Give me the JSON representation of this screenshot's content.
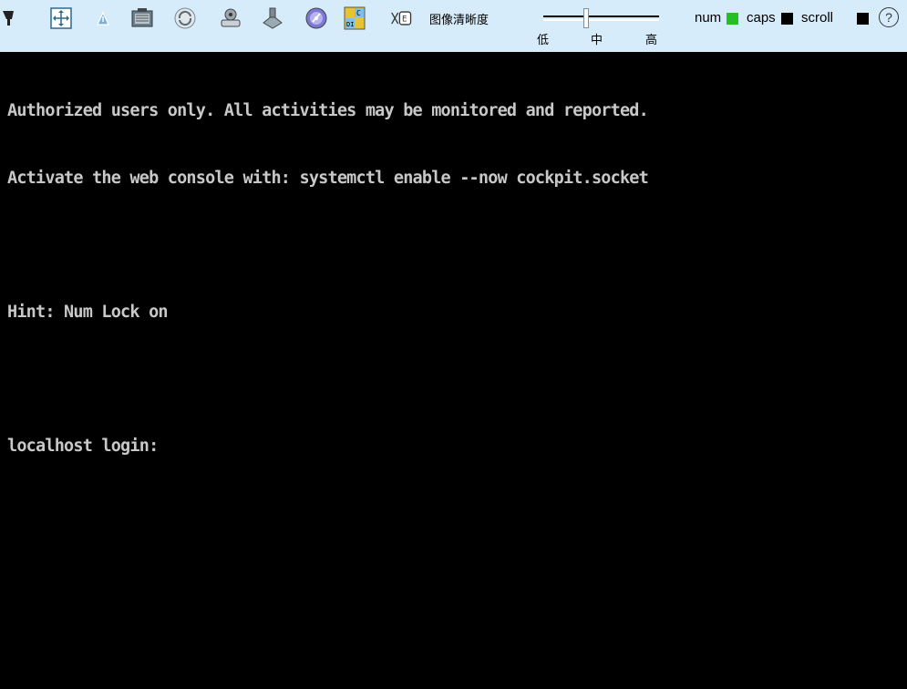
{
  "toolbar": {
    "quality_label": "图像清晰度",
    "slider_ticks": [
      "低",
      "中",
      "高"
    ],
    "slider_value": "中",
    "indicators": [
      {
        "label": "num",
        "color": "#22c022",
        "state": "on"
      },
      {
        "label": "caps",
        "color": "#000000",
        "state": "off"
      },
      {
        "label": "scroll",
        "color": "#000000",
        "state": "off"
      }
    ],
    "help_glyph": "?",
    "icons": [
      "cursor-icon",
      "move-icon",
      "mouse-pointer-icon",
      "screenshot-icon",
      "refresh-icon",
      "usb-drive-icon",
      "floppy-icon",
      "cd-rom-icon",
      "binary-ascii-icon",
      "keyboard-mapping-icon"
    ]
  },
  "console": {
    "lines": [
      "Authorized users only. All activities may be monitored and reported.",
      "Activate the web console with: systemctl enable --now cockpit.socket",
      "",
      "Hint: Num Lock on",
      "",
      "localhost login:"
    ]
  }
}
